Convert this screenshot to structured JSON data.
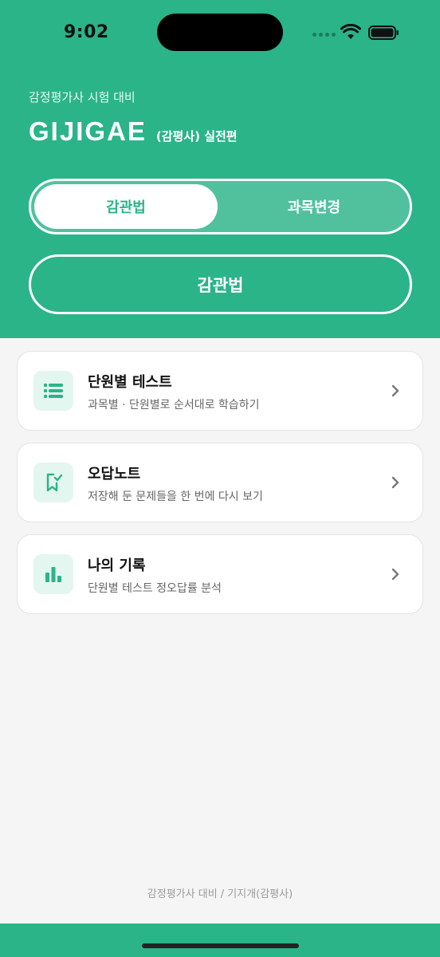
{
  "status_bar": {
    "time": "9:02"
  },
  "header": {
    "subtitle": "감정평가사 시험 대비",
    "brand": "GIJIGAE",
    "edition": "(감평사) 실전편"
  },
  "segmented": {
    "active_label": "감관법",
    "other_label": "과목변경"
  },
  "subject_button": {
    "label": "감관법"
  },
  "menu": [
    {
      "title": "단원별 테스트",
      "desc": "과목별 · 단원별로 순서대로 학습하기",
      "icon": "list-icon"
    },
    {
      "title": "오답노트",
      "desc": "저장해 둔 문제들을 한 번에 다시 보기",
      "icon": "bookmark-check-icon"
    },
    {
      "title": "나의 기록",
      "desc": "단원별 테스트 정오답률 분석",
      "icon": "bar-chart-icon"
    }
  ],
  "footer": {
    "text": "감정평가사 대비 / 기지개(감평사)"
  },
  "colors": {
    "primary": "#2bb488",
    "icon_bg": "#e3f6ef",
    "background": "#f5f5f5"
  }
}
